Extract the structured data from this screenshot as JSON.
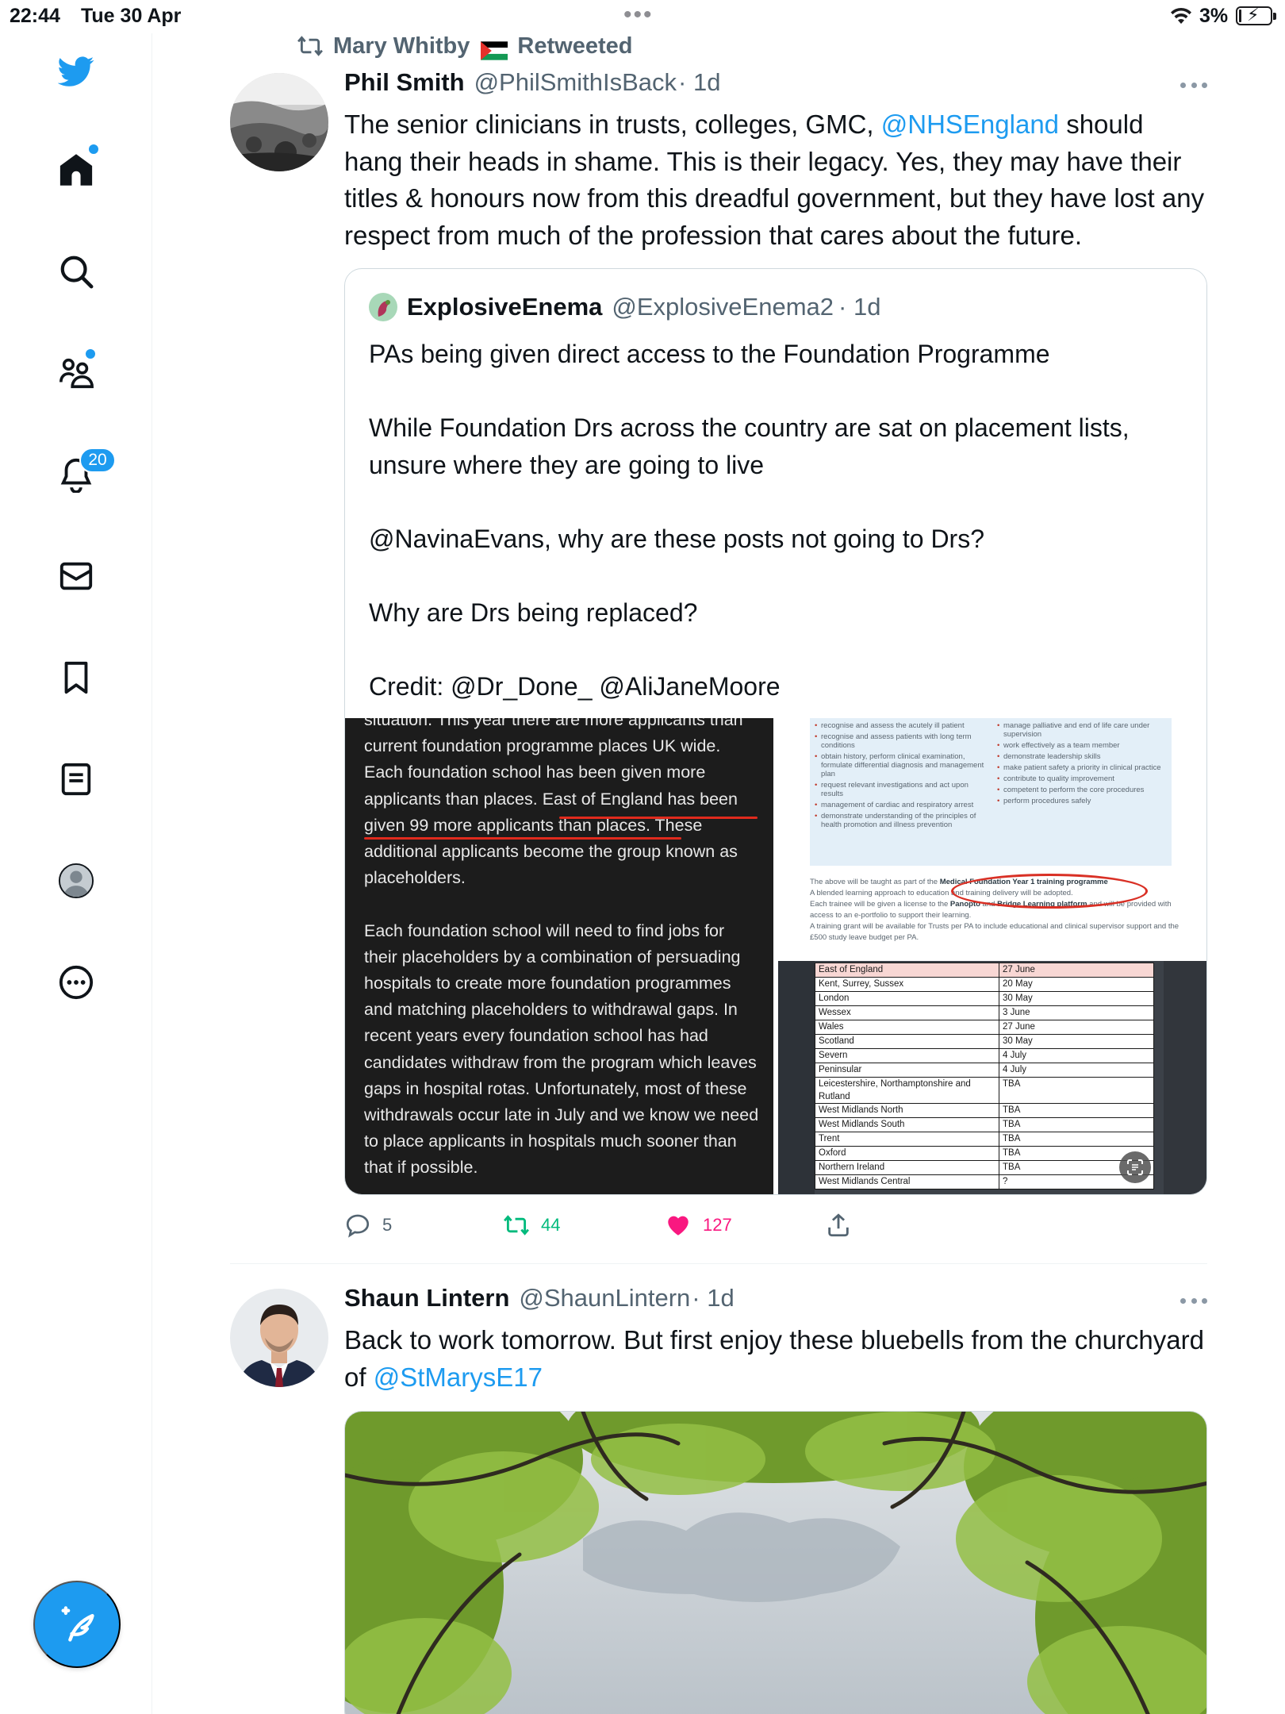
{
  "status_bar": {
    "time": "22:44",
    "date": "Tue 30 Apr",
    "battery_percent": "3%"
  },
  "colors": {
    "accent": "#1d9bf0",
    "retweet_green": "#00ba7c",
    "like_pink": "#f91880",
    "secondary_text": "#536471"
  },
  "sidebar": {
    "items": [
      {
        "name": "twitter-logo",
        "icon": "bird-icon"
      },
      {
        "name": "home",
        "icon": "home-icon",
        "has_dot": true
      },
      {
        "name": "explore",
        "icon": "search-icon"
      },
      {
        "name": "communities",
        "icon": "communities-icon",
        "has_dot": true
      },
      {
        "name": "notifications",
        "icon": "bell-icon",
        "badge": "20"
      },
      {
        "name": "messages",
        "icon": "envelope-icon"
      },
      {
        "name": "bookmarks",
        "icon": "bookmark-icon"
      },
      {
        "name": "lists",
        "icon": "list-icon"
      },
      {
        "name": "profile",
        "icon": "profile-avatar-icon"
      },
      {
        "name": "more",
        "icon": "more-circle-icon"
      }
    ],
    "compose_icon": "compose-feather-icon"
  },
  "tweets": [
    {
      "retweeted_by": "Mary Whitby",
      "retweeted_label": "Retweeted",
      "name": "Phil Smith",
      "handle": "@PhilSmithIsBack",
      "time": "· 1d",
      "text_parts": {
        "before": "The senior clinicians in trusts, colleges, GMC, ",
        "mention": "@NHSEngland",
        "after": " should hang their heads in shame. This is their legacy. Yes, they may have their titles & honours now from this dreadful government, but they have lost any respect from much of the profession that cares about the future."
      },
      "quote": {
        "name": "ExplosiveEnema",
        "handle": "@ExplosiveEnema2",
        "time": "· 1d",
        "paragraphs": [
          "PAs being given direct access to the Foundation Programme",
          "While Foundation Drs across the country are sat on placement lists, unsure where they are going to live",
          "@NavinaEvans, why are these posts not going to Drs?",
          "Why are Drs being replaced?",
          "Credit: @Dr_Done_ @AliJaneMoore"
        ],
        "media_left": {
          "para1": "situation. This year there are more applicants than current foundation programme places UK wide. Each foundation school has been given more applicants than places. East of England has been given 99 more applicants than places. These additional applicants become the group known as placeholders.",
          "para2": "Each foundation school will need to find jobs for their placeholders by a combination of persuading hospitals to create more foundation programmes and matching placeholders to withdrawal gaps. In recent years every foundation school has had candidates withdraw from the program which leaves gaps in hospital rotas. Unfortunately, most of these withdrawals occur late in July and we know we need to place applicants in hospitals much sooner than that if possible."
        },
        "media_right": {
          "bullets_left": [
            "recognise and assess the acutely ill patient",
            "recognise and assess patients with long term conditions",
            "obtain history, perform clinical examination, formulate differential diagnosis and management plan",
            "request relevant investigations and act upon results",
            "management of cardiac and respiratory arrest",
            "demonstrate understanding of the principles of health promotion and illness prevention"
          ],
          "bullets_right": [
            "manage palliative and end of life care under supervision",
            "work effectively as a team member",
            "demonstrate leadership skills",
            "make patient safety a priority in clinical practice",
            "contribute to quality improvement",
            "competent to perform the core procedures",
            "perform procedures safely"
          ],
          "line1_before": "The above will be taught as part of the ",
          "line1_bold": "Medical Foundation Year 1 training programme",
          "line2": "A blended learning approach to education and training delivery will be adopted.",
          "line3_a": "Each trainee will be given a license to the ",
          "line3_b": "Panopto",
          "line3_c": " and ",
          "line3_d": "Bridge Learning platform",
          "line3_e": " and will be provided with access to an e-portfolio to support their learning.",
          "line4": "A training grant will be available for Trusts per PA to include educational and clinical supervisor support and the £500 study leave budget per PA.",
          "table": [
            [
              "East of England",
              "27 June"
            ],
            [
              "Kent, Surrey, Sussex",
              "20 May"
            ],
            [
              "London",
              "30 May"
            ],
            [
              "Wessex",
              "3 June"
            ],
            [
              "Wales",
              "27 June"
            ],
            [
              "Scotland",
              "30 May"
            ],
            [
              "Severn",
              "4 July"
            ],
            [
              "Peninsular",
              "4 July"
            ],
            [
              "Leicestershire, Northamptonshire and Rutland",
              "TBA"
            ],
            [
              "West Midlands North",
              "TBA"
            ],
            [
              "West Midlands South",
              "TBA"
            ],
            [
              "Trent",
              "TBA"
            ],
            [
              "Oxford",
              "TBA"
            ],
            [
              "Northern Ireland",
              "TBA"
            ],
            [
              "West Midlands Central",
              "?"
            ]
          ]
        }
      },
      "actions": {
        "replies": "5",
        "retweets": "44",
        "likes": "127"
      }
    },
    {
      "name": "Shaun Lintern",
      "handle": "@ShaunLintern",
      "time": "· 1d",
      "text_parts": {
        "before": "Back to work tomorrow. But first enjoy these bluebells from the churchyard of ",
        "mention": "@StMarysE17",
        "after": ""
      }
    }
  ]
}
